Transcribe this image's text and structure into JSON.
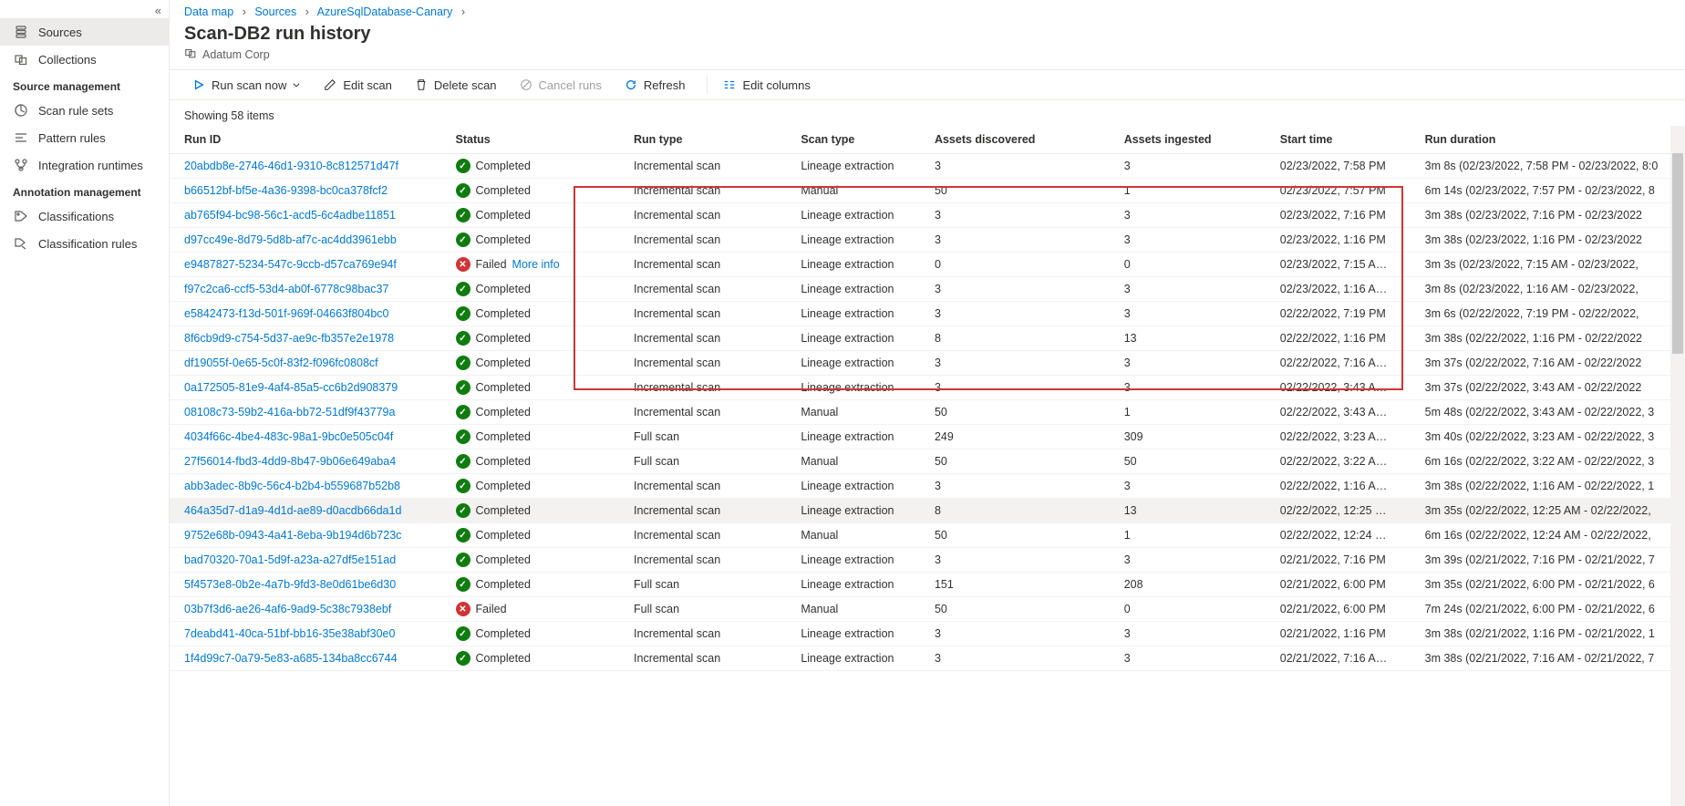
{
  "breadcrumb": {
    "a": "Data map",
    "b": "Sources",
    "c": "AzureSqlDatabase-Canary"
  },
  "sidebar": {
    "items": [
      {
        "label": "Sources"
      },
      {
        "label": "Collections"
      }
    ],
    "sm_heading": "Source management",
    "sm_items": [
      {
        "label": "Scan rule sets"
      },
      {
        "label": "Pattern rules"
      },
      {
        "label": "Integration runtimes"
      }
    ],
    "am_heading": "Annotation management",
    "am_items": [
      {
        "label": "Classifications"
      },
      {
        "label": "Classification rules"
      }
    ]
  },
  "header": {
    "title": "Scan-DB2 run history",
    "subtitle": "Adatum Corp"
  },
  "toolbar": {
    "run": "Run scan now",
    "edit": "Edit scan",
    "delete": "Delete scan",
    "cancel": "Cancel runs",
    "refresh": "Refresh",
    "columns": "Edit columns"
  },
  "count": "Showing 58 items",
  "columns": {
    "id": "Run ID",
    "status": "Status",
    "runtype": "Run type",
    "scantype": "Scan type",
    "assd": "Assets discovered",
    "assi": "Assets ingested",
    "start": "Start time",
    "dur": "Run duration"
  },
  "status_labels": {
    "completed": "Completed",
    "failed": "Failed",
    "more_info": "More info"
  },
  "rows": [
    {
      "id": "20abdb8e-2746-46d1-9310-8c812571d47f",
      "status": "completed",
      "runtype": "Incremental scan",
      "scantype": "Lineage extraction",
      "assd": "3",
      "assi": "3",
      "start": "02/23/2022, 7:58 PM",
      "dur": "3m 8s (02/23/2022, 7:58 PM - 02/23/2022, 8:0"
    },
    {
      "id": "b66512bf-bf5e-4a36-9398-bc0ca378fcf2",
      "status": "completed",
      "runtype": "Incremental scan",
      "scantype": "Manual",
      "assd": "50",
      "assi": "1",
      "start": "02/23/2022, 7:57 PM",
      "dur": "6m 14s (02/23/2022, 7:57 PM - 02/23/2022, 8"
    },
    {
      "id": "ab765f94-bc98-56c1-acd5-6c4adbe11851",
      "status": "completed",
      "runtype": "Incremental scan",
      "scantype": "Lineage extraction",
      "assd": "3",
      "assi": "3",
      "start": "02/23/2022, 7:16 PM",
      "dur": "3m 38s (02/23/2022, 7:16 PM - 02/23/2022"
    },
    {
      "id": "d97cc49e-8d79-5d8b-af7c-ac4dd3961ebb",
      "status": "completed",
      "runtype": "Incremental scan",
      "scantype": "Lineage extraction",
      "assd": "3",
      "assi": "3",
      "start": "02/23/2022, 1:16 PM",
      "dur": "3m 38s (02/23/2022, 1:16 PM - 02/23/2022"
    },
    {
      "id": "e9487827-5234-547c-9ccb-d57ca769e94f",
      "status": "failed",
      "runtype": "Incremental scan",
      "scantype": "Lineage extraction",
      "assd": "0",
      "assi": "0",
      "start": "02/23/2022, 7:15 A…",
      "dur": "3m 3s (02/23/2022, 7:15 AM - 02/23/2022,"
    },
    {
      "id": "f97c2ca6-ccf5-53d4-ab0f-6778c98bac37",
      "status": "completed",
      "runtype": "Incremental scan",
      "scantype": "Lineage extraction",
      "assd": "3",
      "assi": "3",
      "start": "02/23/2022, 1:16 A…",
      "dur": "3m 8s (02/23/2022, 1:16 AM - 02/23/2022,"
    },
    {
      "id": "e5842473-f13d-501f-969f-04663f804bc0",
      "status": "completed",
      "runtype": "Incremental scan",
      "scantype": "Lineage extraction",
      "assd": "3",
      "assi": "3",
      "start": "02/22/2022, 7:19 PM",
      "dur": "3m 6s (02/22/2022, 7:19 PM - 02/22/2022,"
    },
    {
      "id": "8f6cb9d9-c754-5d37-ae9c-fb357e2e1978",
      "status": "completed",
      "runtype": "Incremental scan",
      "scantype": "Lineage extraction",
      "assd": "8",
      "assi": "13",
      "start": "02/22/2022, 1:16 PM",
      "dur": "3m 38s (02/22/2022, 1:16 PM - 02/22/2022"
    },
    {
      "id": "df19055f-0e65-5c0f-83f2-f096fc0808cf",
      "status": "completed",
      "runtype": "Incremental scan",
      "scantype": "Lineage extraction",
      "assd": "3",
      "assi": "3",
      "start": "02/22/2022, 7:16 A…",
      "dur": "3m 37s (02/22/2022, 7:16 AM - 02/22/2022"
    },
    {
      "id": "0a172505-81e9-4af4-85a5-cc6b2d908379",
      "status": "completed",
      "runtype": "Incremental scan",
      "scantype": "Lineage extraction",
      "assd": "3",
      "assi": "3",
      "start": "02/22/2022, 3:43 A…",
      "dur": "3m 37s (02/22/2022, 3:43 AM - 02/22/2022"
    },
    {
      "id": "08108c73-59b2-416a-bb72-51df9f43779a",
      "status": "completed",
      "runtype": "Incremental scan",
      "scantype": "Manual",
      "assd": "50",
      "assi": "1",
      "start": "02/22/2022, 3:43 A…",
      "dur": "5m 48s (02/22/2022, 3:43 AM - 02/22/2022, 3"
    },
    {
      "id": "4034f66c-4be4-483c-98a1-9bc0e505c04f",
      "status": "completed",
      "runtype": "Full scan",
      "scantype": "Lineage extraction",
      "assd": "249",
      "assi": "309",
      "start": "02/22/2022, 3:23 A…",
      "dur": "3m 40s (02/22/2022, 3:23 AM - 02/22/2022, 3"
    },
    {
      "id": "27f56014-fbd3-4dd9-8b47-9b06e649aba4",
      "status": "completed",
      "runtype": "Full scan",
      "scantype": "Manual",
      "assd": "50",
      "assi": "50",
      "start": "02/22/2022, 3:22 A…",
      "dur": "6m 16s (02/22/2022, 3:22 AM - 02/22/2022, 3"
    },
    {
      "id": "abb3adec-8b9c-56c4-b2b4-b559687b52b8",
      "status": "completed",
      "runtype": "Incremental scan",
      "scantype": "Lineage extraction",
      "assd": "3",
      "assi": "3",
      "start": "02/22/2022, 1:16 A…",
      "dur": "3m 38s (02/22/2022, 1:16 AM - 02/22/2022, 1"
    },
    {
      "id": "464a35d7-d1a9-4d1d-ae89-d0acdb66da1d",
      "status": "completed",
      "runtype": "Incremental scan",
      "scantype": "Lineage extraction",
      "assd": "8",
      "assi": "13",
      "start": "02/22/2022, 12:25 …",
      "dur": "3m 35s (02/22/2022, 12:25 AM - 02/22/2022,",
      "hovered": true
    },
    {
      "id": "9752e68b-0943-4a41-8eba-9b194d6b723c",
      "status": "completed",
      "runtype": "Incremental scan",
      "scantype": "Manual",
      "assd": "50",
      "assi": "1",
      "start": "02/22/2022, 12:24 …",
      "dur": "6m 16s (02/22/2022, 12:24 AM - 02/22/2022,"
    },
    {
      "id": "bad70320-70a1-5d9f-a23a-a27df5e151ad",
      "status": "completed",
      "runtype": "Incremental scan",
      "scantype": "Lineage extraction",
      "assd": "3",
      "assi": "3",
      "start": "02/21/2022, 7:16 PM",
      "dur": "3m 39s (02/21/2022, 7:16 PM - 02/21/2022, 7"
    },
    {
      "id": "5f4573e8-0b2e-4a7b-9fd3-8e0d61be6d30",
      "status": "completed",
      "runtype": "Full scan",
      "scantype": "Lineage extraction",
      "assd": "151",
      "assi": "208",
      "start": "02/21/2022, 6:00 PM",
      "dur": "3m 35s (02/21/2022, 6:00 PM - 02/21/2022, 6"
    },
    {
      "id": "03b7f3d6-ae26-4af6-9ad9-5c38c7938ebf",
      "status": "failed_plain",
      "runtype": "Full scan",
      "scantype": "Manual",
      "assd": "50",
      "assi": "0",
      "start": "02/21/2022, 6:00 PM",
      "dur": "7m 24s (02/21/2022, 6:00 PM - 02/21/2022, 6"
    },
    {
      "id": "7deabd41-40ca-51bf-bb16-35e38abf30e0",
      "status": "completed",
      "runtype": "Incremental scan",
      "scantype": "Lineage extraction",
      "assd": "3",
      "assi": "3",
      "start": "02/21/2022, 1:16 PM",
      "dur": "3m 38s (02/21/2022, 1:16 PM - 02/21/2022, 1"
    },
    {
      "id": "1f4d99c7-0a79-5e83-a685-134ba8cc6744",
      "status": "completed",
      "runtype": "Incremental scan",
      "scantype": "Lineage extraction",
      "assd": "3",
      "assi": "3",
      "start": "02/21/2022, 7:16 A…",
      "dur": "3m 38s (02/21/2022, 7:16 AM - 02/21/2022, 7"
    }
  ]
}
